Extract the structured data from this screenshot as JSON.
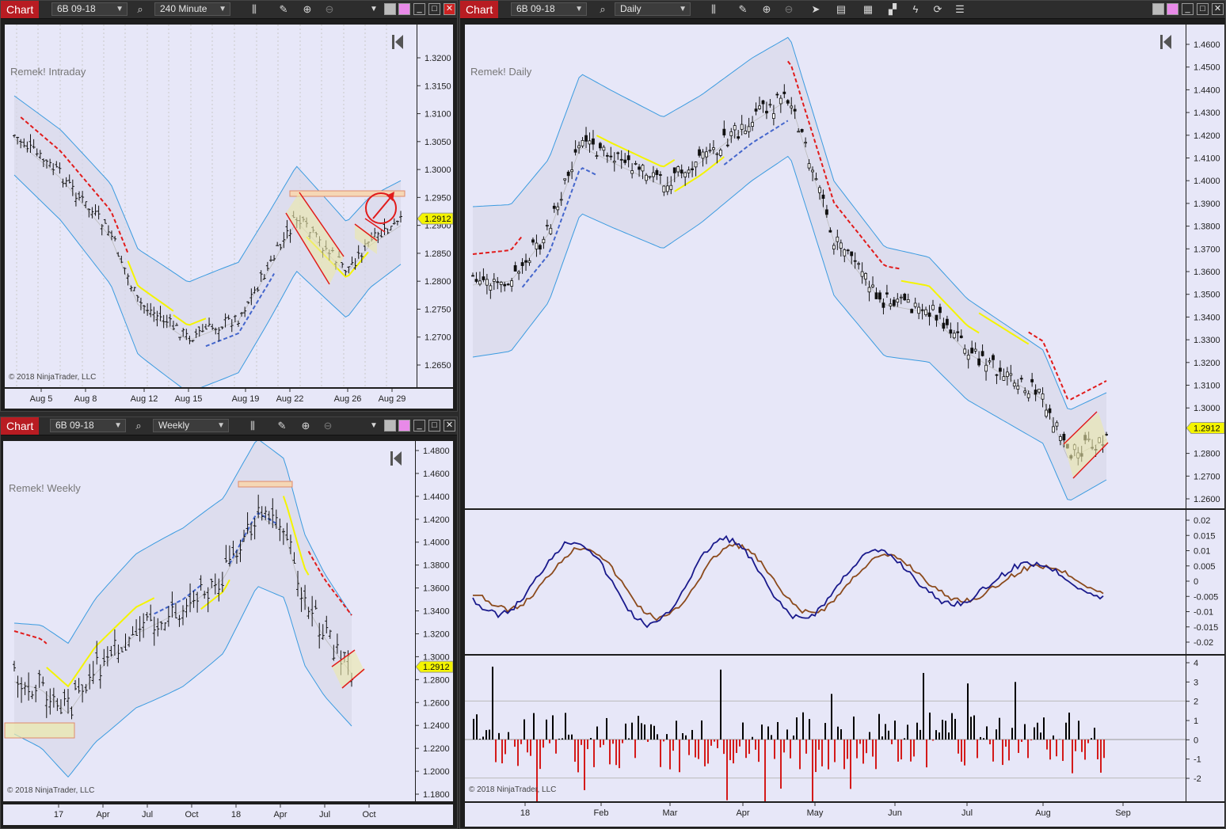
{
  "windows": [
    {
      "id": "intraday",
      "toolbar_label": "Chart",
      "instrument": "6B 09-18",
      "timeframe": "240 Minute",
      "title": "Remek! Intraday",
      "copyright": "© 2018 NinjaTrader, LLC",
      "price_ticks": [
        "1.3200",
        "1.3150",
        "1.3100",
        "1.3050",
        "1.3000",
        "1.2950",
        "1.2900",
        "1.2850",
        "1.2800",
        "1.2750",
        "1.2700",
        "1.2650"
      ],
      "date_ticks": [
        "Aug 5",
        "Aug 8",
        "Aug 12",
        "Aug 15",
        "Aug 19",
        "Aug 22",
        "Aug 26",
        "Aug 29"
      ],
      "last_price": "1.2912"
    },
    {
      "id": "weekly",
      "toolbar_label": "Chart",
      "instrument": "6B 09-18",
      "timeframe": "Weekly",
      "title": "Remek! Weekly",
      "copyright": "© 2018 NinjaTrader, LLC",
      "price_ticks": [
        "1.4800",
        "1.4600",
        "1.4400",
        "1.4200",
        "1.4000",
        "1.3800",
        "1.3600",
        "1.3400",
        "1.3200",
        "1.3000",
        "1.2800",
        "1.2600",
        "1.2400",
        "1.2200",
        "1.2000",
        "1.1800"
      ],
      "date_ticks": [
        "17",
        "Apr",
        "Jul",
        "Oct",
        "18",
        "Apr",
        "Jul",
        "Oct"
      ],
      "last_price": "1.2912"
    },
    {
      "id": "daily",
      "toolbar_label": "Chart",
      "instrument": "6B 09-18",
      "timeframe": "Daily",
      "title": "Remek! Daily",
      "copyright": "© 2018 NinjaTrader, LLC",
      "price_ticks": [
        "1.4600",
        "1.4500",
        "1.4400",
        "1.4300",
        "1.4200",
        "1.4100",
        "1.4000",
        "1.3900",
        "1.3800",
        "1.3700",
        "1.3600",
        "1.3500",
        "1.3400",
        "1.3300",
        "1.3200",
        "1.3100",
        "1.3000",
        "1.2800",
        "1.2700",
        "1.2600"
      ],
      "osc_ticks": [
        "0.02",
        "0.015",
        "0.01",
        "0.005",
        "0",
        "-0.005",
        "-0.01",
        "-0.015",
        "-0.02"
      ],
      "hist_ticks": [
        "4",
        "3",
        "2",
        "1",
        "0",
        "-1",
        "-2"
      ],
      "date_ticks": [
        "18",
        "Feb",
        "Mar",
        "Apr",
        "May",
        "Jun",
        "Jul",
        "Aug",
        "Sep"
      ],
      "last_price": "1.2912"
    }
  ],
  "icons": {
    "search": "search-icon",
    "bars": "bar-type-icon",
    "pencil": "draw-icon",
    "zoom_in": "zoom-in-icon",
    "zoom_out": "zoom-out-icon",
    "pointer": "pointer-icon",
    "properties": "properties-icon",
    "indicators": "indicators-icon",
    "strategies": "strategies-icon",
    "analyzer": "analyzer-icon",
    "refresh": "refresh-icon",
    "list": "list-icon",
    "scroll_end": "scroll-to-end-icon"
  },
  "colors": {
    "bg_plot": "#e7e7f8",
    "toolbar_label": "#b81c22",
    "band": "#3b9be0",
    "trail_red": "#e11b1b",
    "trail_blue": "#4466cc",
    "trail_yellow": "#f4f400",
    "osc_fast": "#1a1a8c",
    "osc_slow": "#8b4a1c",
    "hist_pos": "#000000",
    "hist_neg": "#d41a1a",
    "price_marker": "#f4f400"
  }
}
